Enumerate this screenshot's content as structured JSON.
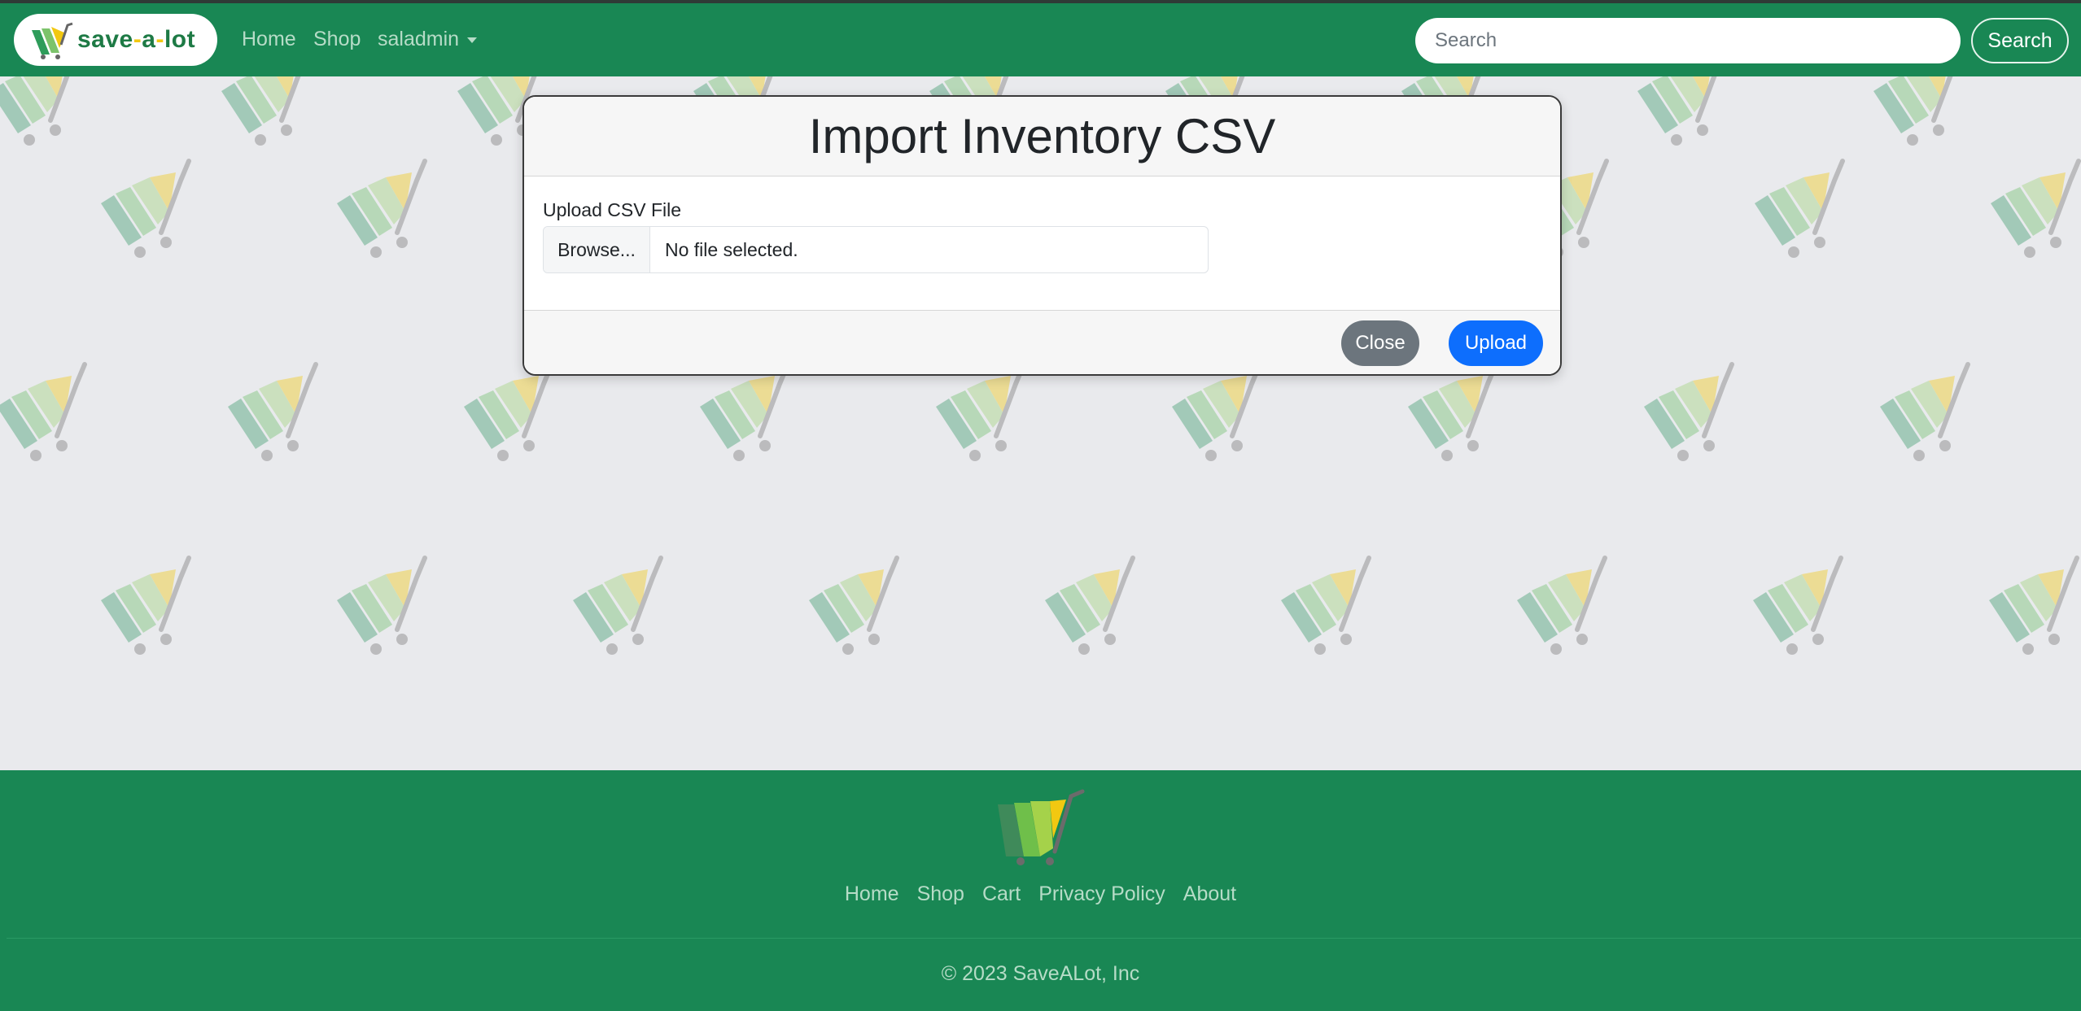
{
  "colors": {
    "navbar": "#198754",
    "page_background": "#e9eaed",
    "close_button": "#6c757d",
    "upload_button": "#0d6efd",
    "brand_text": "#1e7a45",
    "link": "#b6dcc7"
  },
  "navbar": {
    "brand": {
      "part1": "save",
      "dash1": "-",
      "part2": "a",
      "dash2": "-",
      "part3": "lot",
      "icon": "shopping-cart-icon"
    },
    "links": [
      {
        "label": "Home"
      },
      {
        "label": "Shop"
      },
      {
        "label": "saladmin",
        "dropdown": true
      }
    ],
    "search": {
      "placeholder": "Search",
      "value": "",
      "button_label": "Search"
    }
  },
  "modal": {
    "title": "Import Inventory CSV",
    "file_label": "Upload CSV File",
    "browse_label": "Browse...",
    "file_status": "No file selected.",
    "close_label": "Close",
    "upload_label": "Upload"
  },
  "footer": {
    "logo_icon": "shopping-cart-icon",
    "links": [
      {
        "label": "Home"
      },
      {
        "label": "Shop"
      },
      {
        "label": "Cart"
      },
      {
        "label": "Privacy Policy"
      },
      {
        "label": "About"
      }
    ],
    "copyright": "© 2023 SaveALot, Inc"
  }
}
